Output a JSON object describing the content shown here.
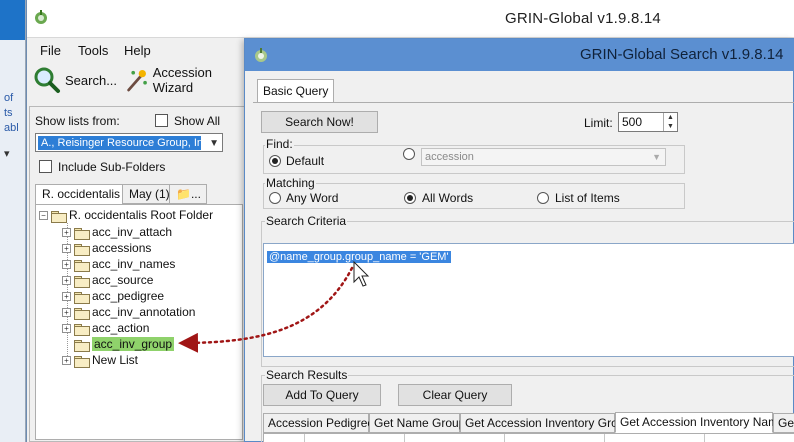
{
  "desktop_strip": {
    "fragments": [
      "of",
      "ts",
      "abl"
    ]
  },
  "main_window": {
    "title": "GRIN-Global v1.9.8.14",
    "menu": [
      "File",
      "Tools",
      "Help"
    ],
    "toolbar": {
      "search_label": "Search...",
      "wizard_label": "Accession Wizard"
    }
  },
  "left_pane": {
    "show_lists_label": "Show lists from:",
    "show_all_label": "Show All",
    "show_all_checked": false,
    "owner_value": "A., Reisinger Resource Group, Inc.",
    "include_subfolders_label": "Include Sub-Folders",
    "include_subfolders_checked": false,
    "tabs": [
      "R. occidentalis",
      "May (1)"
    ],
    "root_folder": "R. occidentalis Root Folder",
    "items": [
      "acc_inv_attach",
      "accessions",
      "acc_inv_names",
      "acc_source",
      "acc_pedigree",
      "acc_inv_annotation",
      "acc_action",
      "acc_inv_group",
      "New List"
    ],
    "selected_item": "acc_inv_group"
  },
  "search_window": {
    "title": "GRIN-Global Search v1.9.8.14",
    "tab": "Basic Query",
    "search_now_label": "Search Now!",
    "limit_label": "Limit:",
    "limit_value": "500",
    "find": {
      "title": "Find:",
      "default_label": "Default",
      "accession_label": "accession",
      "selected": "Default"
    },
    "matching": {
      "title": "Matching",
      "options": [
        "Any Word",
        "All Words",
        "List of Items"
      ],
      "selected": "All Words"
    },
    "criteria": {
      "title": "Search Criteria",
      "text": "@name_group.group_name = 'GEM'"
    },
    "results": {
      "title": "Search Results",
      "add_to_query_label": "Add To Query",
      "clear_query_label": "Clear Query",
      "tabs": [
        "Accession Pedigree",
        "Get Name Group",
        "Get Accession Inventory Group",
        "Get Accession Inventory Name",
        "Ge"
      ],
      "active_tab": "Get Accession Inventory Name"
    }
  },
  "colors": {
    "title_bar_search": "#5b8fd1",
    "selection_blue": "#3b86e0",
    "tree_highlight": "#8fd26b",
    "annotation_arrow": "#a01515"
  }
}
